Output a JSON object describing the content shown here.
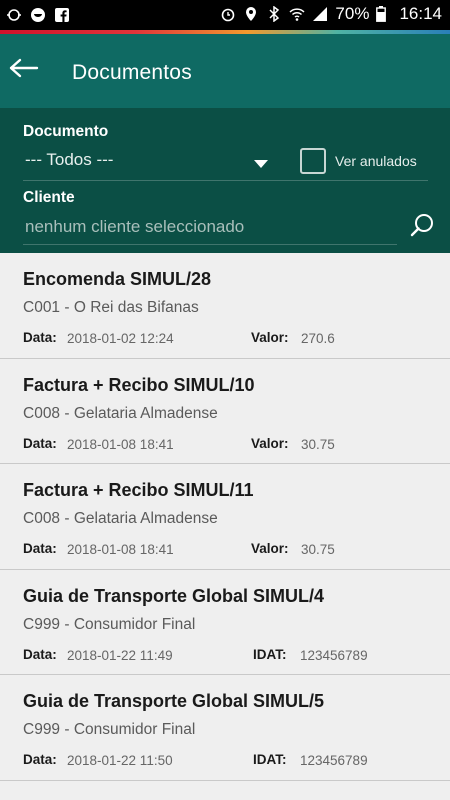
{
  "statusbar": {
    "battery": "70%",
    "time": "16:14"
  },
  "appbar": {
    "title": "Documentos"
  },
  "filter": {
    "document_label": "Documento",
    "document_selected": "--- Todos ---",
    "show_cancelled_label": "Ver anulados",
    "client_label": "Cliente",
    "client_placeholder": "nenhum cliente seleccionado"
  },
  "labels": {
    "data": "Data:",
    "valor": "Valor:",
    "idat": "IDAT:"
  },
  "documents": [
    {
      "title": "Encomenda SIMUL/28",
      "client": "C001 - O Rei das Bifanas",
      "date": "2018-01-02 12:24",
      "value": "270.6"
    },
    {
      "title": "Factura + Recibo SIMUL/10",
      "client": "C008 - Gelataria Almadense",
      "date": "2018-01-08 18:41",
      "value": "30.75"
    },
    {
      "title": "Factura + Recibo SIMUL/11",
      "client": "C008 - Gelataria Almadense",
      "date": "2018-01-08 18:41",
      "value": "30.75"
    },
    {
      "title": "Guia de Transporte Global SIMUL/4",
      "client": "C999 - Consumidor Final",
      "date": "2018-01-22 11:49",
      "idat": "123456789"
    },
    {
      "title": "Guia de Transporte Global SIMUL/5",
      "client": "C999 - Consumidor Final",
      "date": "2018-01-22 11:50",
      "idat": "123456789"
    }
  ]
}
